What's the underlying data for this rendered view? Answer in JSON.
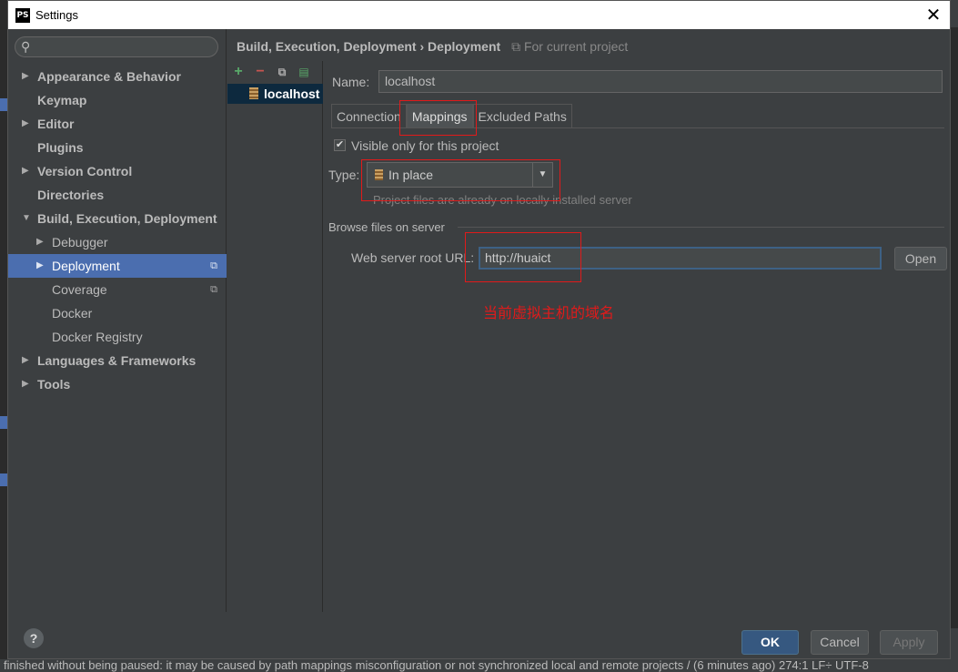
{
  "window": {
    "title": "Settings",
    "app_icon": "PS"
  },
  "search": {
    "placeholder": ""
  },
  "sidebar": {
    "items": [
      {
        "label": "Appearance & Behavior"
      },
      {
        "label": "Keymap"
      },
      {
        "label": "Editor"
      },
      {
        "label": "Plugins"
      },
      {
        "label": "Version Control"
      },
      {
        "label": "Directories"
      },
      {
        "label": "Build, Execution, Deployment"
      },
      {
        "label": "Debugger"
      },
      {
        "label": "Deployment"
      },
      {
        "label": "Coverage"
      },
      {
        "label": "Docker"
      },
      {
        "label": "Docker Registry"
      },
      {
        "label": "Languages & Frameworks"
      },
      {
        "label": "Tools"
      }
    ]
  },
  "breadcrumb": {
    "parent": "Build, Execution, Deployment",
    "separator": "›",
    "current": "Deployment",
    "scope": "For current project"
  },
  "servers": {
    "items": [
      {
        "name": "localhost"
      }
    ]
  },
  "form": {
    "name_label": "Name:",
    "name_value": "localhost",
    "tabs": [
      {
        "label": "Connection"
      },
      {
        "label": "Mappings"
      },
      {
        "label": "Excluded Paths"
      }
    ],
    "visible_only_label": "Visible only for this project",
    "type_label": "Type:",
    "type_value": "In place",
    "type_hint": "Project files are already on locally installed server",
    "browse_section": "Browse files on server",
    "url_label": "Web server root URL:",
    "url_value": "http://huaict",
    "open_label": "Open",
    "annotation": "当前虚拟主机的域名"
  },
  "footer": {
    "help": "?",
    "ok": "OK",
    "cancel": "Cancel",
    "apply": "Apply"
  },
  "status_bar": {
    "text": "finished without being paused: it may be caused by path mappings misconfiguration or not synchronized local and remote projects / (6 minutes ago)   274:1   LF÷   UTF-8"
  },
  "colors": {
    "accent": "#4b6eaf",
    "highlight_box": "#e11a1a",
    "ok_button": "#365880"
  }
}
